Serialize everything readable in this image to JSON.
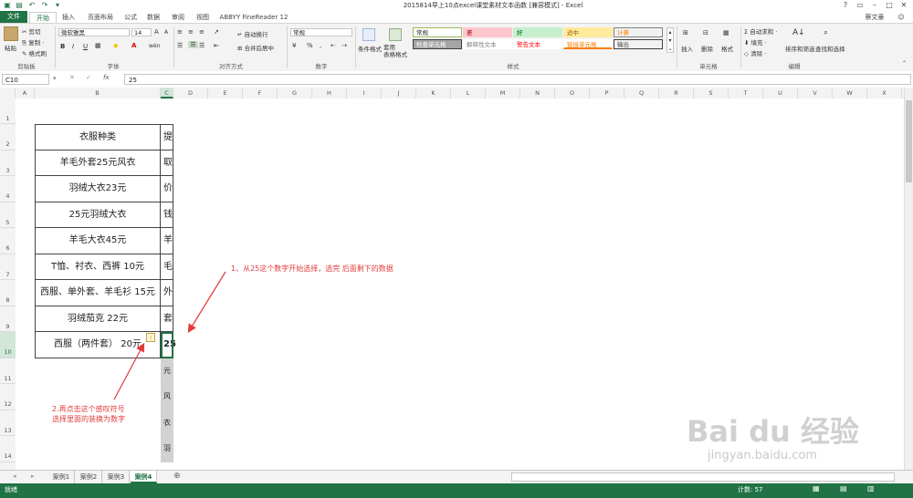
{
  "window": {
    "title": "2015814早上10点excel课堂素材文本函数 [兼容模式] - Excel",
    "user": "蔡文豪"
  },
  "ribbon_tabs": [
    "文件",
    "开始",
    "插入",
    "页面布局",
    "公式",
    "数据",
    "审阅",
    "视图",
    "ABBYY FineReader 12"
  ],
  "clipboard": {
    "paste": "粘贴",
    "cut": "剪切",
    "copy": "复制 ·",
    "format_painter": "格式刷",
    "label": "剪贴板"
  },
  "font": {
    "name": "微软雅黑",
    "size": "14",
    "bold": "B",
    "italic": "I",
    "underline": "U",
    "label": "字体",
    "grow": "A",
    "shrink": "A",
    "phonetic": "wén"
  },
  "alignment": {
    "wrap": "自动换行",
    "merge": "合并后居中",
    "label": "对齐方式"
  },
  "number": {
    "format": "常规",
    "label": "数字",
    "percent": "%",
    "comma": ","
  },
  "styles": {
    "conditional": "条件格式",
    "table": "套用\n表格格式",
    "items": [
      {
        "label": "常规",
        "bg": "#ffffff",
        "color": "#222222",
        "border": "#9bbb59"
      },
      {
        "label": "差",
        "bg": "#ffc7ce",
        "color": "#9c0006",
        "border": "#ffc7ce"
      },
      {
        "label": "好",
        "bg": "#c6efce",
        "color": "#006100",
        "border": "#c6efce"
      },
      {
        "label": "适中",
        "bg": "#ffeb9c",
        "color": "#9c5700",
        "border": "#ffeb9c"
      },
      {
        "label": "计算",
        "bg": "#f2f2f2",
        "color": "#fa7d00",
        "border": "#7f7f7f"
      },
      {
        "label": "检查单元格",
        "bg": "#a5a5a5",
        "color": "#ffffff",
        "border": "#3f3f3f"
      },
      {
        "label": "解释性文本",
        "bg": "#ffffff",
        "color": "#7f7f7f",
        "border": "#ffffff"
      },
      {
        "label": "警告文本",
        "bg": "#ffffff",
        "color": "#ff0000",
        "border": "#ffffff"
      },
      {
        "label": "链接单元格",
        "bg": "#ffffff",
        "color": "#fa7d00",
        "border": "#ffffff"
      },
      {
        "label": "输出",
        "bg": "#f2f2f2",
        "color": "#3f3f3f",
        "border": "#3f3f3f"
      }
    ],
    "label": "样式"
  },
  "cells_group": {
    "insert": "插入",
    "delete": "删除",
    "format": "格式",
    "label": "单元格"
  },
  "editing": {
    "autosum": "自动求和 ·",
    "fill": "填充 ·",
    "clear": "清除 ·",
    "sort": "排序和筛选",
    "find": "查找和选择",
    "label": "编辑"
  },
  "formula_bar": {
    "name_box": "C10",
    "fx": "fx",
    "value": "25"
  },
  "columns": [
    "A",
    "B",
    "C",
    "D",
    "E",
    "F",
    "G",
    "H",
    "I",
    "J",
    "K",
    "L",
    "M",
    "N",
    "O",
    "P",
    "Q",
    "R",
    "S",
    "T",
    "U",
    "V",
    "W",
    "X"
  ],
  "rows": [
    "1",
    "2",
    "3",
    "4",
    "5",
    "6",
    "7",
    "8",
    "9",
    "10",
    "11",
    "12",
    "13",
    "14"
  ],
  "table_b": [
    "衣服种类",
    "羊毛外套25元风衣",
    "羽绒大衣23元",
    "25元羽绒大衣",
    "羊毛大衣45元",
    "T恤、衬衣、西裤 10元",
    "西服、单外套、羊毛衫 15元",
    "羽绒茄克 22元",
    "西服（两件套） 20元"
  ],
  "table_c": [
    "提",
    "取",
    "价",
    "钱",
    "羊",
    "毛",
    "外",
    "套",
    "25",
    "元",
    "风",
    "衣",
    "羽"
  ],
  "annotations": {
    "a1": "1、从25这个数字开始选择，选完 后面剩下的数据",
    "a2_line1": "2.再点击这个感叹符号",
    "a2_line2": "选择里面的装换为数字"
  },
  "sheets": [
    "案例1",
    "案例2",
    "案例3",
    "案例4"
  ],
  "active_sheet": "案例4",
  "status": {
    "ready": "就绪",
    "count": "计数: 57"
  },
  "watermark": {
    "brand": "Bai du 经验",
    "url": "jingyan.baidu.com"
  },
  "colors": {
    "excel_green": "#217346",
    "annotation_red": "#e23b3b"
  }
}
